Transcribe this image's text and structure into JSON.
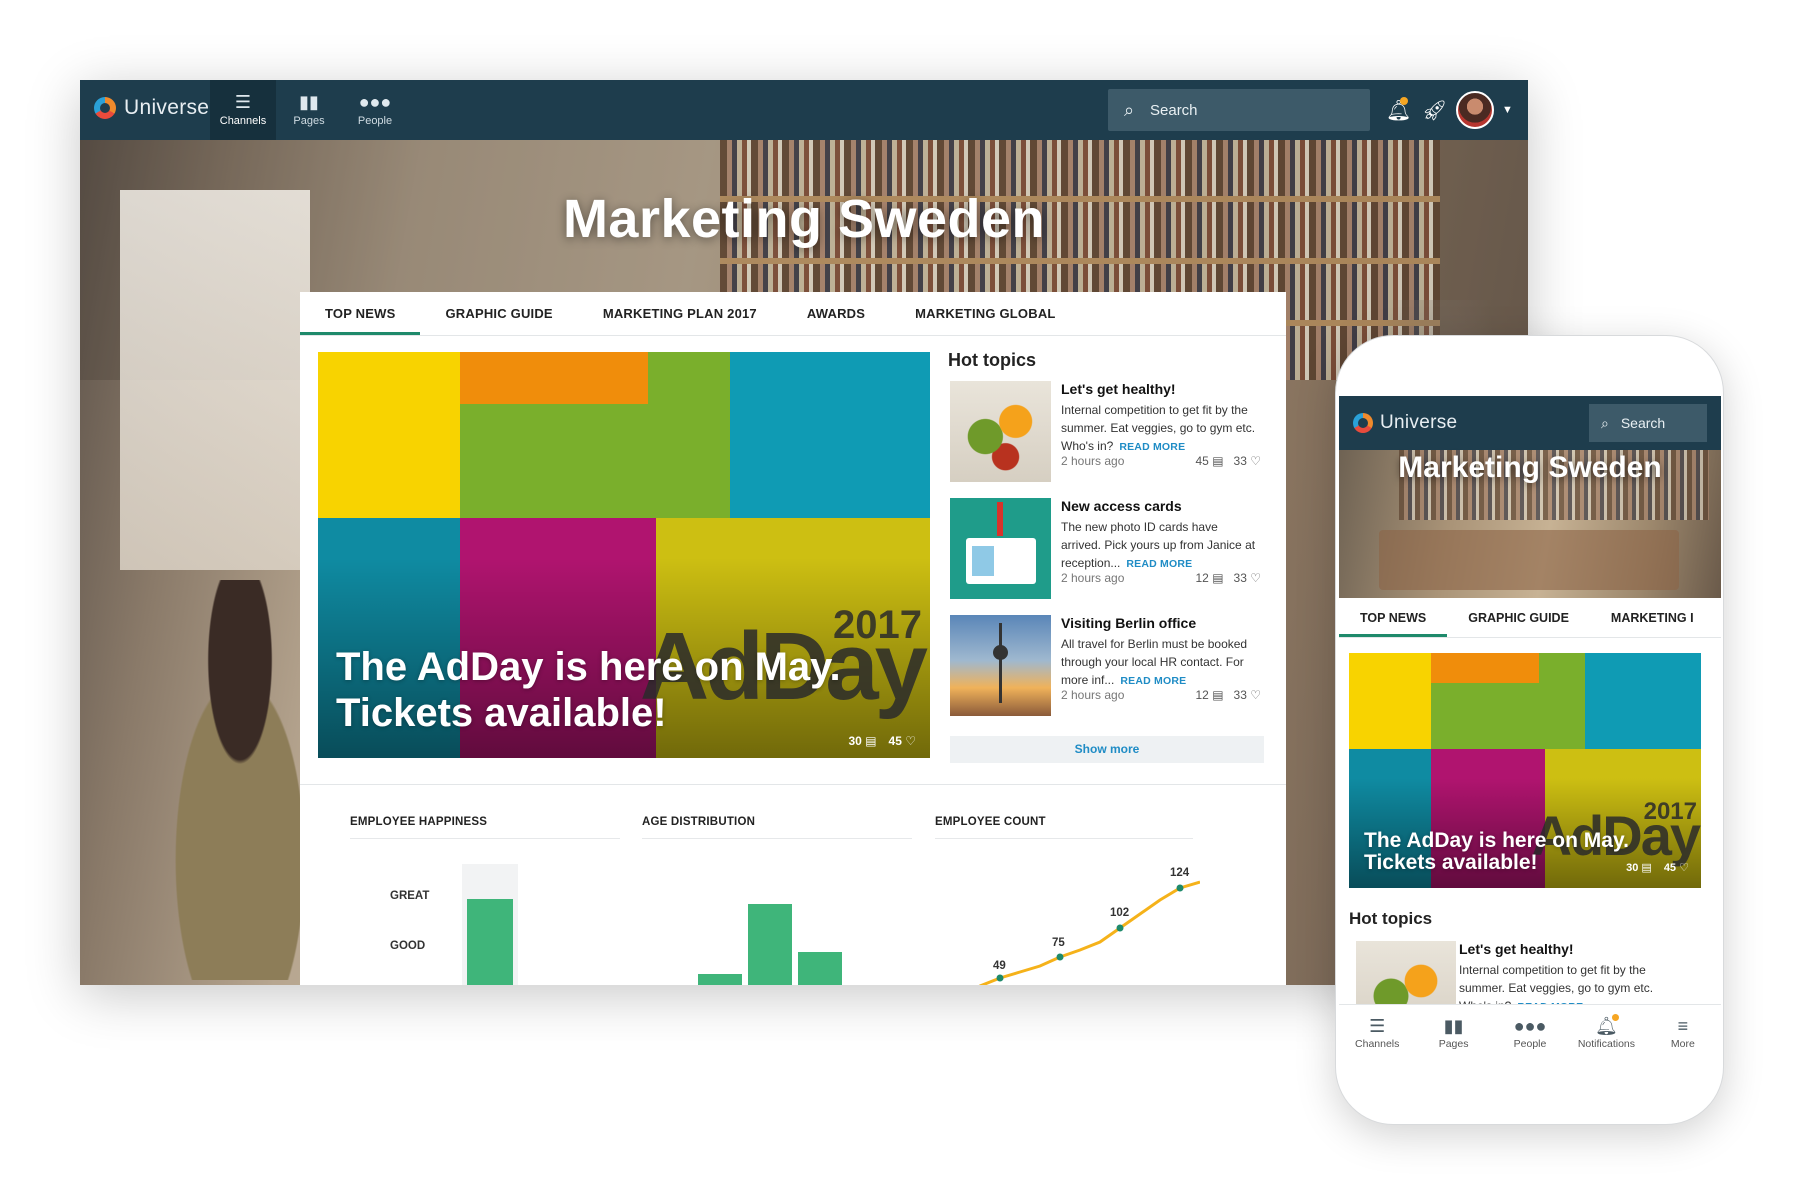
{
  "app": {
    "name": "Universe"
  },
  "nav": [
    {
      "label": "Channels",
      "icon": "layers-icon"
    },
    {
      "label": "Pages",
      "icon": "book-icon"
    },
    {
      "label": "People",
      "icon": "people-icon"
    }
  ],
  "search": {
    "placeholder": "Search"
  },
  "channel": {
    "title": "Marketing Sweden"
  },
  "tabs": [
    "TOP NEWS",
    "GRAPHIC GUIDE",
    "MARKETING PLAN 2017",
    "AWARDS",
    "MARKETING GLOBAL"
  ],
  "mobile_tabs": [
    "TOP NEWS",
    "GRAPHIC GUIDE",
    "MARKETING I"
  ],
  "featured": {
    "headline_line1": "The AdDay is here on May.",
    "headline_line2": "Tickets available!",
    "logo_word": "AdDay",
    "logo_year": "2017",
    "comments": "30",
    "likes": "45"
  },
  "hot_topics": {
    "title": "Hot topics",
    "read_more": "READ MORE",
    "show_more": "Show more",
    "items": [
      {
        "title": "Let's get healthy!",
        "text": "Internal competition to get fit by the summer. Eat veggies, go to gym etc. Who's in?",
        "time": "2 hours ago",
        "comments": "45",
        "likes": "33"
      },
      {
        "title": "New access cards",
        "text": "The new photo ID cards have arrived. Pick yours up from Janice at reception...",
        "time": "2 hours ago",
        "comments": "12",
        "likes": "33"
      },
      {
        "title": "Visiting Berlin office",
        "text": "All travel for Berlin must be booked through your local HR contact. For more inf...",
        "time": "2 hours ago",
        "comments": "12",
        "likes": "33"
      }
    ]
  },
  "mobile_hot_topic_text": "Internal competition to get fit by the summer. Eat veggies, go to gym etc. Who's in?",
  "widgets": {
    "happiness": {
      "title": "EMPLOYEE HAPPINESS",
      "levels": [
        "GREAT",
        "GOOD"
      ]
    },
    "age": {
      "title": "AGE DISTRIBUTION"
    },
    "count": {
      "title": "EMPLOYEE COUNT",
      "labels": [
        "49",
        "75",
        "102",
        "124"
      ]
    }
  },
  "mobile_nav": [
    {
      "label": "Channels",
      "icon": "layers-icon"
    },
    {
      "label": "Pages",
      "icon": "book-icon"
    },
    {
      "label": "People",
      "icon": "people-icon"
    },
    {
      "label": "Notifications",
      "icon": "bell-icon"
    },
    {
      "label": "More",
      "icon": "menu-icon"
    }
  ],
  "colors": {
    "topbar": "#1e3d4d",
    "accent": "#1e8a6b",
    "link": "#1f8cc5",
    "bar": "#3fb57a",
    "line": "#f5b21a"
  }
}
